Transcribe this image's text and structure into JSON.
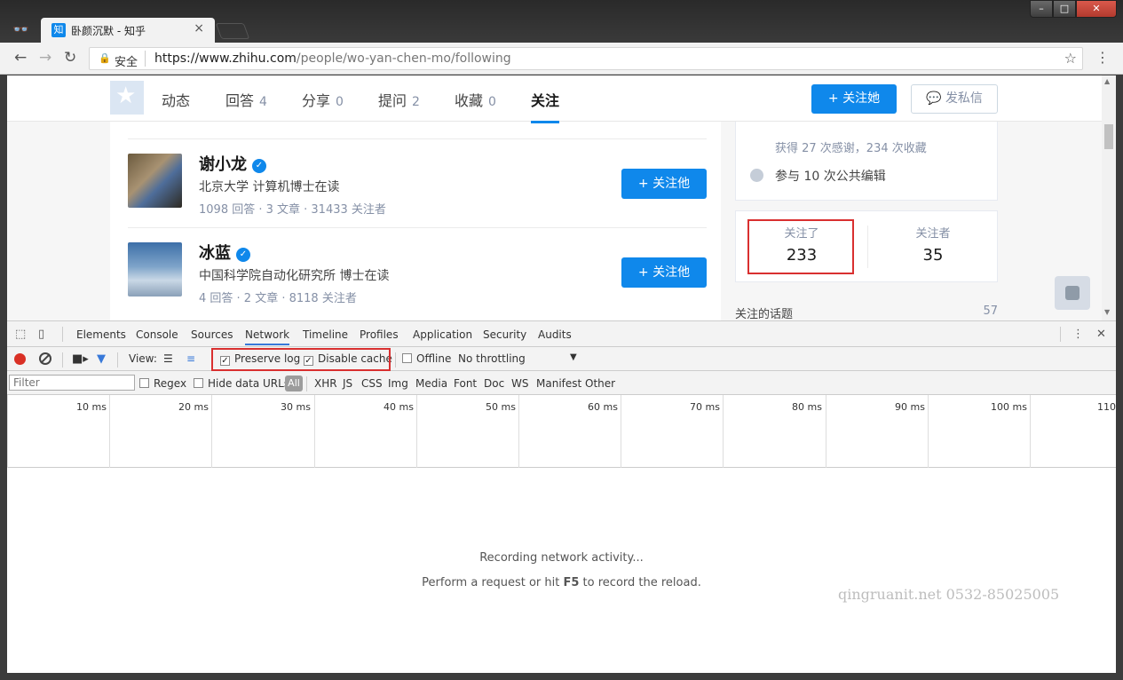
{
  "browser": {
    "tab_title": "卧颜沉默 - 知乎",
    "tab_favicon": "知",
    "tab_close": "×",
    "security_label": "安全",
    "url_host": "https://www.zhihu.com",
    "url_path": "/people/wo-yan-chen-mo/following",
    "incognito_icon": "incognito-icon",
    "window_buttons": {
      "minimize": "–",
      "maximize": "□",
      "close": "✕"
    }
  },
  "zhihu": {
    "nav_tabs": [
      {
        "label": "动态",
        "count": ""
      },
      {
        "label": "回答",
        "count": "4"
      },
      {
        "label": "分享",
        "count": "0"
      },
      {
        "label": "提问",
        "count": "2"
      },
      {
        "label": "收藏",
        "count": "0"
      },
      {
        "label": "关注",
        "count": ""
      }
    ],
    "follow_her": "+ 关注她",
    "message": "发私信",
    "people": [
      {
        "name": "谢小龙",
        "headline": "北京大学 计算机博士在读",
        "stats": "1098 回答 · 3 文章 · 31433 关注者",
        "follow": "+ 关注他"
      },
      {
        "name": "冰蓝",
        "headline": "中国科学院自动化研究所 博士在读",
        "stats": "4 回答 · 2 文章 · 8118 关注者",
        "follow": "+ 关注他"
      }
    ],
    "sidebar": {
      "line_thanks": "获得 27 次感谢，234 次收藏",
      "line_edit": "参与 10 次公共编辑",
      "following_label": "关注了",
      "following_value": "233",
      "followers_label": "关注者",
      "followers_value": "35",
      "topics_label": "关注的话题",
      "topics_value": "57"
    }
  },
  "devtools": {
    "tabs": [
      "Elements",
      "Console",
      "Sources",
      "Network",
      "Timeline",
      "Profiles",
      "Application",
      "Security",
      "Audits"
    ],
    "active_tab": "Network",
    "view_label": "View:",
    "preserve_log": "Preserve log",
    "disable_cache": "Disable cache",
    "offline": "Offline",
    "throttling": "No throttling",
    "filter_placeholder": "Filter",
    "regex": "Regex",
    "hide_data_urls": "Hide data URLs",
    "all": "All",
    "types": [
      "XHR",
      "JS",
      "CSS",
      "Img",
      "Media",
      "Font",
      "Doc",
      "WS",
      "Manifest",
      "Other"
    ],
    "ticks": [
      "10 ms",
      "20 ms",
      "30 ms",
      "40 ms",
      "50 ms",
      "60 ms",
      "70 ms",
      "80 ms",
      "90 ms",
      "100 ms",
      "110"
    ],
    "empty_line1": "Recording network activity...",
    "empty_line2_pre": "Perform a request or hit ",
    "empty_line2_key": "F5",
    "empty_line2_post": " to record the reload."
  },
  "watermark": "qingruanit.net 0532-85025005",
  "colors": {
    "zhihu_blue": "#0f88eb",
    "highlight_red": "#d93030",
    "record_red": "#d93025"
  }
}
